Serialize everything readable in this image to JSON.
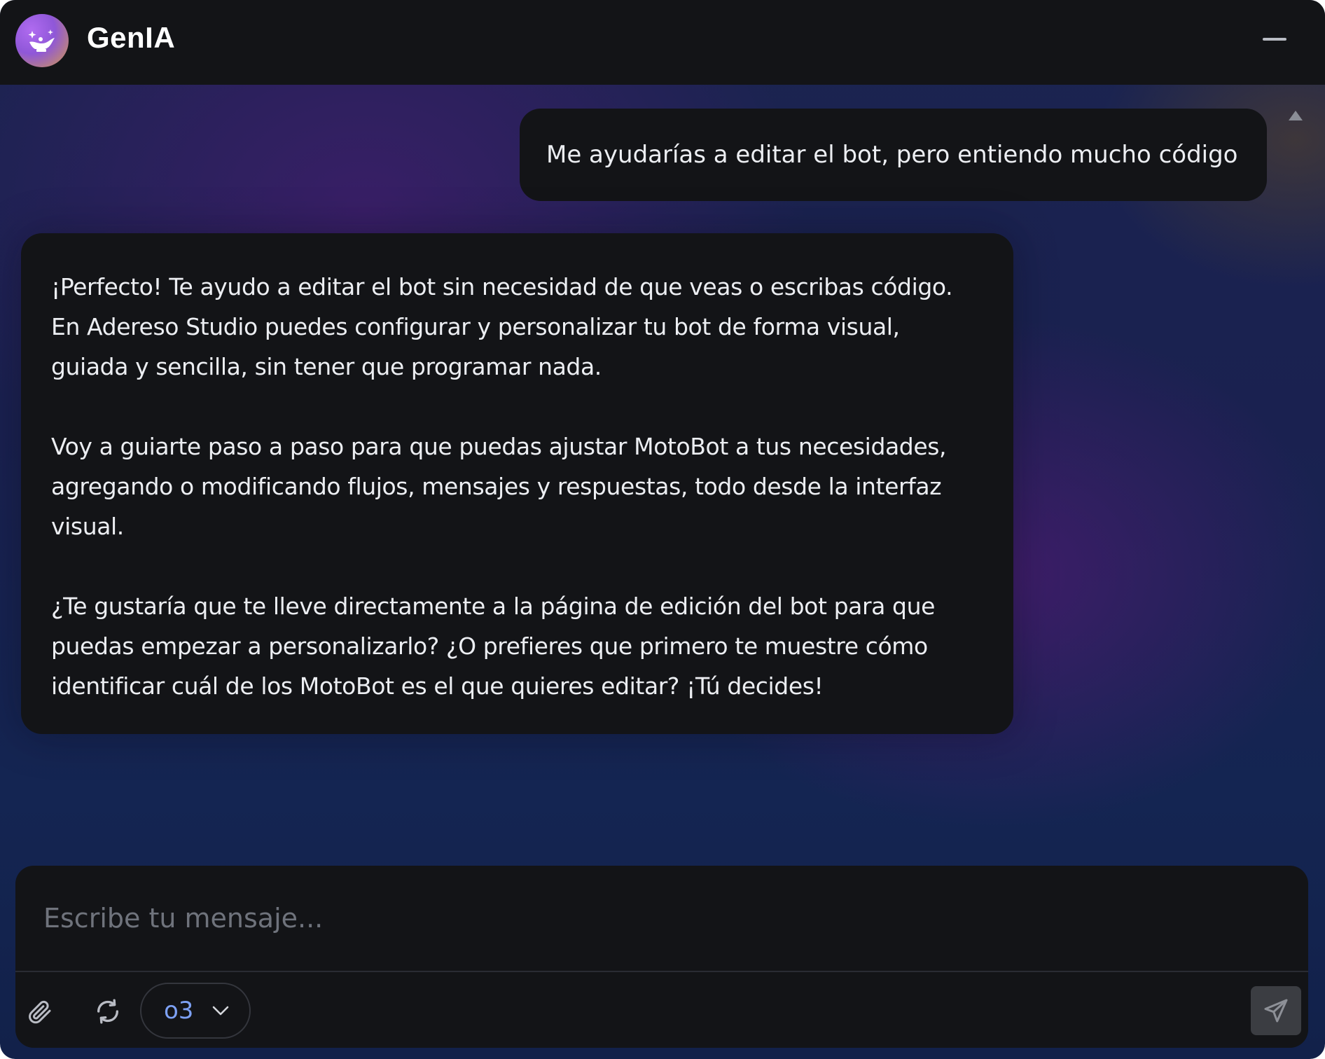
{
  "app": {
    "title": "GenIA",
    "logo_icon": "genie-lamp-icon",
    "accent_color": "#7da1f5"
  },
  "header": {
    "minimize_icon": "minimize-icon"
  },
  "messages": [
    {
      "role": "user",
      "text": "Me ayudarías a editar el bot, pero entiendo mucho código"
    },
    {
      "role": "assistant",
      "paragraphs": [
        "¡Perfecto! Te ayudo a editar el bot sin necesidad de que veas o escribas código. En Adereso Studio puedes configurar y personalizar tu bot de forma visual, guiada y sencilla, sin tener que programar nada.",
        "Voy a guiarte paso a paso para que puedas ajustar MotoBot a tus necesidades, agregando o modificando flujos, mensajes y respuestas, todo desde la interfaz visual.",
        "¿Te gustaría que te lleve directamente a la página de edición del bot para que puedas empezar a personalizarlo? ¿O prefieres que primero te muestre cómo identificar cuál de los MotoBot es el que quieres editar? ¡Tú decides!"
      ]
    }
  ],
  "composer": {
    "placeholder": "Escribe tu mensaje...",
    "value": "",
    "attach_icon": "paperclip-icon",
    "refresh_icon": "refresh-icon",
    "model": {
      "selected": "o3",
      "icon": "chevron-down-icon"
    },
    "send_icon": "send-icon"
  }
}
